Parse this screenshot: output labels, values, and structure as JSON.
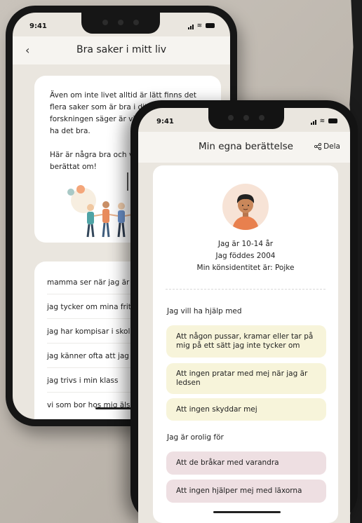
{
  "phone_back": {
    "status": {
      "time": "9:41"
    },
    "header": {
      "title": "Bra saker i mitt liv"
    },
    "intro": {
      "paragraph1": "Även om inte livet alltid är lätt finns det flera saker som är bra i ditt liv och som forskningen säger är viktig för att du ska ha det bra.",
      "paragraph2": "Här är några bra och viktiga saker du har berättat om!"
    },
    "items": [
      "mamma ser när jag är ledsen",
      "jag tycker om mina fritidsintressen",
      "jag har kompisar i skolan",
      "jag känner ofta att jag duger",
      "jag trivs i min klass",
      "vi som bor hos mig älskar varandra"
    ]
  },
  "phone_front": {
    "status": {
      "time": "9:41"
    },
    "header": {
      "title": "Min egna berättelse",
      "share_label": "Dela"
    },
    "profile": {
      "age": "Jag är 10-14 år",
      "born": "Jag föddes 2004",
      "gender": "Min könsidentitet är: Pojke"
    },
    "help": {
      "title": "Jag vill ha hjälp med",
      "items": [
        "Att någon pussar, kramar eller tar på mig på ett sätt jag inte tycker om",
        "Att ingen pratar med mej när jag är ledsen",
        "Att ingen skyddar mej"
      ]
    },
    "worry": {
      "title": "Jag är orolig för",
      "items": [
        "Att de bråkar med varandra",
        "Att ingen hjälper mej med läxorna"
      ]
    }
  },
  "colors": {
    "background": "#c4bdb5",
    "screen": "#eae6df",
    "help_pill": "#f7f4da",
    "worry_pill": "#eedfe2",
    "avatar_bg": "#f7e3d6"
  }
}
